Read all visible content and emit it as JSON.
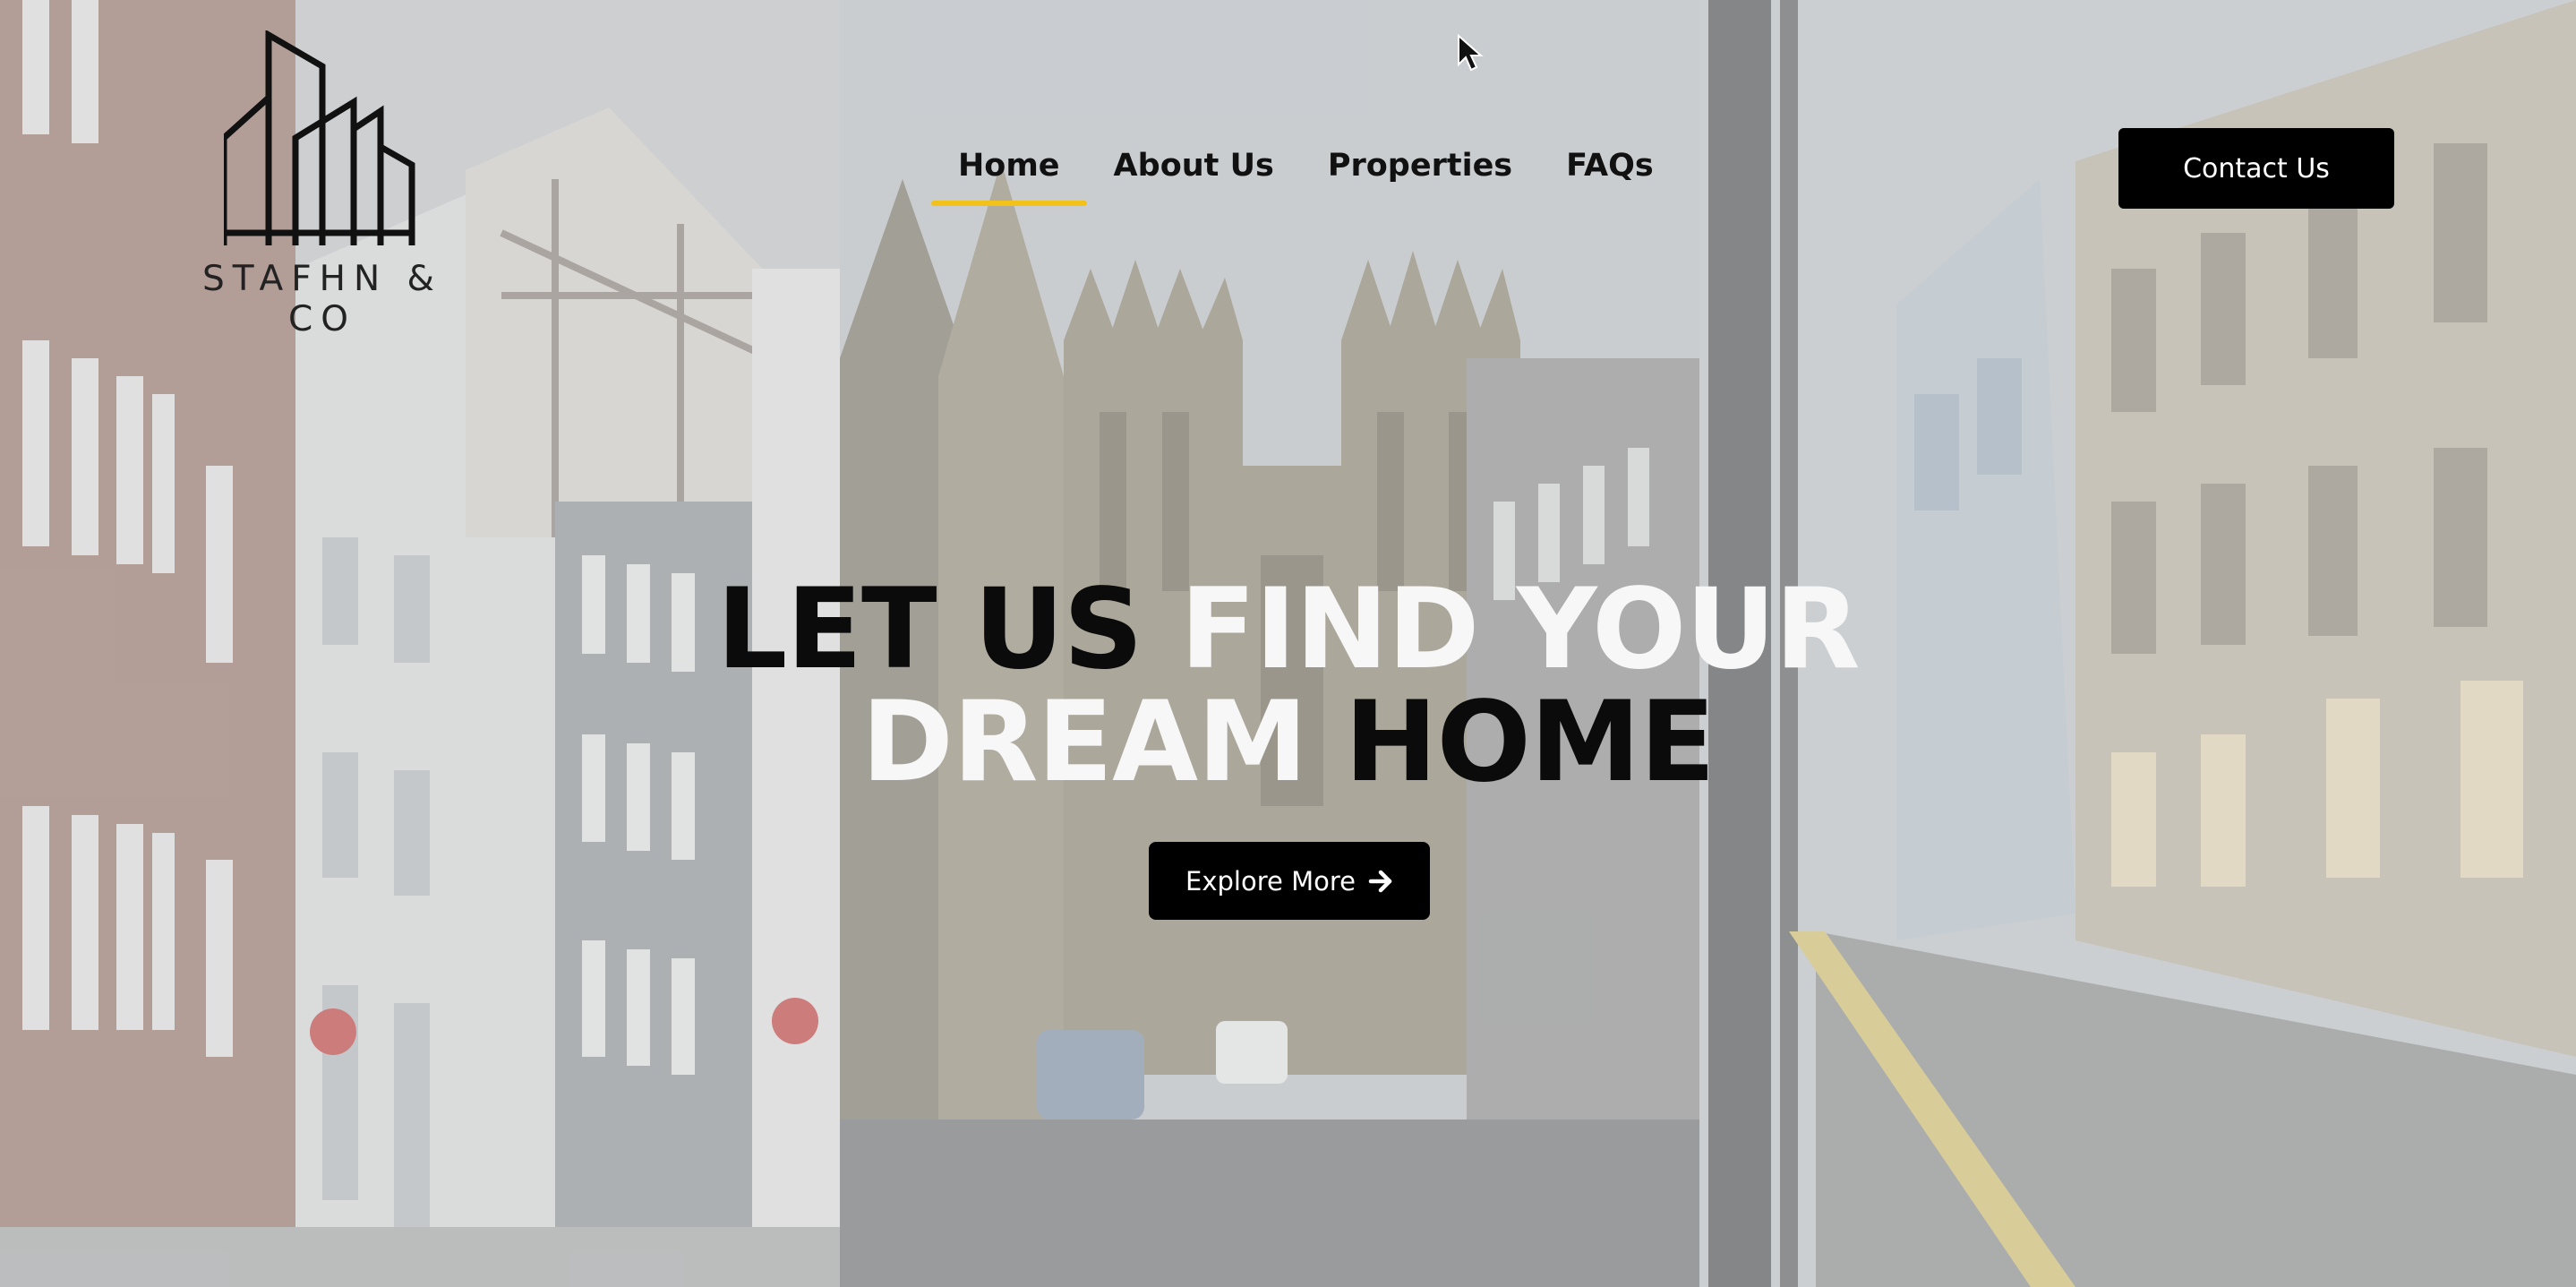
{
  "brand": {
    "name": "STAFHN & CO"
  },
  "nav": {
    "items": [
      {
        "label": "Home",
        "active": true
      },
      {
        "label": "About Us",
        "active": false
      },
      {
        "label": "Properties",
        "active": false
      },
      {
        "label": "FAQs",
        "active": false
      }
    ],
    "contact_label": "Contact Us"
  },
  "hero": {
    "line1_dark": "LET US",
    "line1_light": "FIND YOUR",
    "line2_light": "DREAM",
    "line2_dark": "HOME",
    "cta_label": "Explore More",
    "cta_icon": "arrow-right-icon"
  },
  "colors": {
    "accent": "#f2c21a",
    "button_bg": "#000000",
    "text_dark": "#0b0b0b",
    "text_light": "#f7f7f7"
  }
}
